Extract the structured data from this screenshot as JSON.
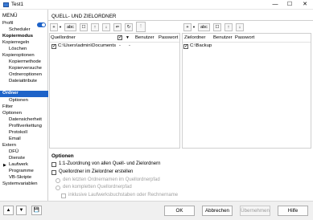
{
  "window": {
    "title": "Test1",
    "controls": {
      "minimize": "—",
      "maximize": "☐",
      "close": "✕"
    }
  },
  "menu_header": "MENÜ",
  "profile_toggle": {
    "on": true
  },
  "tree": [
    {
      "label": "Profil"
    },
    {
      "label": "Scheduler"
    },
    {
      "label": "Kopiermodus"
    },
    {
      "label": "Kopierregeln"
    },
    {
      "label": "Löschen"
    },
    {
      "label": "Kopieroptionen"
    },
    {
      "label": "Kopiermethode"
    },
    {
      "label": "Kopierversuche"
    },
    {
      "label": "Ordneroptionen"
    },
    {
      "label": "Dateiattribute"
    },
    {
      "label": "Ordner"
    },
    {
      "label": "Optionen"
    },
    {
      "label": "Filter"
    },
    {
      "label": "Optionen"
    },
    {
      "label": "Datensicherheit"
    },
    {
      "label": "Profilverkettung"
    },
    {
      "label": "Protokoll"
    },
    {
      "label": "Email"
    },
    {
      "label": "Extern"
    },
    {
      "label": "DFÜ"
    },
    {
      "label": "Dienste"
    },
    {
      "label": "Laufwerk"
    },
    {
      "label": "Programme"
    },
    {
      "label": "VB-Skripte"
    },
    {
      "label": "Systemvariablen"
    }
  ],
  "main_header": "QUELL- UND ZIELORDNER",
  "source_toolbar": [
    "+",
    "abc",
    "☐",
    "↑",
    "↓",
    "⇐",
    "↻",
    "⋮"
  ],
  "target_toolbar": [
    "+",
    "abc",
    "☐",
    "↑",
    "↓"
  ],
  "source_table": {
    "columns": [
      "Quellordner",
      "Benutzer",
      "Passwort"
    ],
    "rows": [
      {
        "checked": true,
        "path": "C:\\Users\\admin\\Documents",
        "col2": "-",
        "col3": "-"
      }
    ]
  },
  "target_table": {
    "columns": [
      "Zielordner",
      "Benutzer",
      "Passwort"
    ],
    "rows": [
      {
        "checked": true,
        "path": "C:\\Backup"
      }
    ]
  },
  "options": {
    "title": "Optionen",
    "items": [
      {
        "label": "1:1-Zuordnung von allen Quell- und Zielordnern",
        "checked": false
      },
      {
        "label": "Quellordner im Zielordner erstellen",
        "checked": false
      },
      {
        "label": "den letzten Ordnernamen im Quellordnerpfad",
        "disabled": true
      },
      {
        "label": "den kompletten Quellordnerpfad",
        "disabled": true
      },
      {
        "label": "inklusive Laufwerksbuchstaben oder Rechnername",
        "disabled": true
      }
    ]
  },
  "footer": {
    "nav_up": "▲",
    "nav_down": "▼",
    "nav_save": "💾",
    "ok": "OK",
    "cancel": "Abbrechen",
    "apply": "Übernehmen",
    "help": "Hilfe"
  },
  "colors": {
    "selection": "#1e63c8"
  }
}
